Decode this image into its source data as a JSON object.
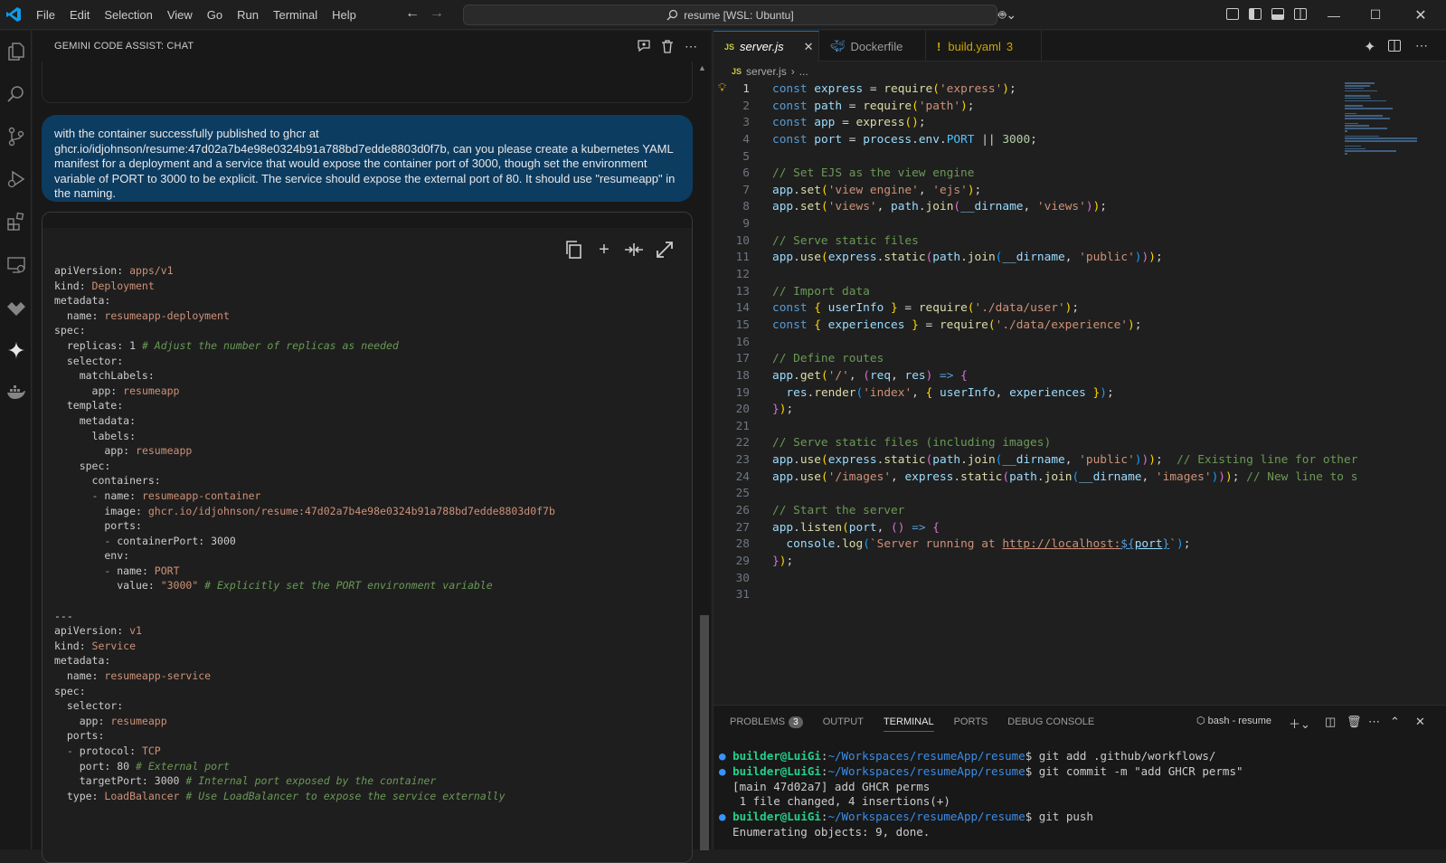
{
  "menu": [
    "File",
    "Edit",
    "Selection",
    "View",
    "Go",
    "Run",
    "Terminal",
    "Help"
  ],
  "command_center": "resume [WSL: Ubuntu]",
  "chat": {
    "title": "GEMINI CODE ASSIST: CHAT",
    "user_message": "with the container successfully published to ghcr at ghcr.io/idjohnson/resume:47d02a7b4e98e0324b91a788bd7edde8803d0f7b, can you please create a kubernetes YAML manifest for a deployment and a service that would expose the container port of 3000, though set the environment variable of PORT to 3000 to be explicit. The service should expose the external port of 80. It should use \"resumeapp\" in the naming.",
    "yaml": [
      [
        [
          "k",
          "apiVersion: "
        ],
        [
          "v",
          "apps/v1"
        ]
      ],
      [
        [
          "k",
          "kind: "
        ],
        [
          "v",
          "Deployment"
        ]
      ],
      [
        [
          "k",
          "metadata:"
        ]
      ],
      [
        [
          "k",
          "  name: "
        ],
        [
          "v",
          "resumeapp-deployment"
        ]
      ],
      [
        [
          "k",
          "spec:"
        ]
      ],
      [
        [
          "k",
          "  replicas: "
        ],
        [
          "d",
          "1 "
        ],
        [
          "c",
          "# Adjust the number of replicas as needed"
        ]
      ],
      [
        [
          "k",
          "  selector:"
        ]
      ],
      [
        [
          "k",
          "    matchLabels:"
        ]
      ],
      [
        [
          "k",
          "      app: "
        ],
        [
          "v",
          "resumeapp"
        ]
      ],
      [
        [
          "k",
          "  template:"
        ]
      ],
      [
        [
          "k",
          "    metadata:"
        ]
      ],
      [
        [
          "k",
          "      labels:"
        ]
      ],
      [
        [
          "k",
          "        app: "
        ],
        [
          "v",
          "resumeapp"
        ]
      ],
      [
        [
          "k",
          "    spec:"
        ]
      ],
      [
        [
          "k",
          "      containers:"
        ]
      ],
      [
        [
          "v",
          "      - "
        ],
        [
          "k",
          "name: "
        ],
        [
          "v",
          "resumeapp-container"
        ]
      ],
      [
        [
          "k",
          "        image: "
        ],
        [
          "v",
          "ghcr.io/idjohnson/resume:47d02a7b4e98e0324b91a788bd7edde8803d0f7b"
        ]
      ],
      [
        [
          "k",
          "        ports:"
        ]
      ],
      [
        [
          "v",
          "        - "
        ],
        [
          "k",
          "containerPort: "
        ],
        [
          "d",
          "3000"
        ]
      ],
      [
        [
          "k",
          "        env:"
        ]
      ],
      [
        [
          "v",
          "        - "
        ],
        [
          "k",
          "name: "
        ],
        [
          "v",
          "PORT"
        ]
      ],
      [
        [
          "k",
          "          value: "
        ],
        [
          "v",
          "\"3000\" "
        ],
        [
          "c",
          "# Explicitly set the PORT environment variable"
        ]
      ],
      [
        [
          "k",
          ""
        ]
      ],
      [
        [
          "d",
          "---"
        ]
      ],
      [
        [
          "k",
          "apiVersion: "
        ],
        [
          "v",
          "v1"
        ]
      ],
      [
        [
          "k",
          "kind: "
        ],
        [
          "v",
          "Service"
        ]
      ],
      [
        [
          "k",
          "metadata:"
        ]
      ],
      [
        [
          "k",
          "  name: "
        ],
        [
          "v",
          "resumeapp-service"
        ]
      ],
      [
        [
          "k",
          "spec:"
        ]
      ],
      [
        [
          "k",
          "  selector:"
        ]
      ],
      [
        [
          "k",
          "    app: "
        ],
        [
          "v",
          "resumeapp"
        ]
      ],
      [
        [
          "k",
          "  ports:"
        ]
      ],
      [
        [
          "v",
          "  - "
        ],
        [
          "k",
          "protocol: "
        ],
        [
          "v",
          "TCP"
        ]
      ],
      [
        [
          "k",
          "    port: "
        ],
        [
          "d",
          "80 "
        ],
        [
          "c",
          "# External port"
        ]
      ],
      [
        [
          "k",
          "    targetPort: "
        ],
        [
          "d",
          "3000 "
        ],
        [
          "c",
          "# Internal port exposed by the container"
        ]
      ],
      [
        [
          "k",
          "  type: "
        ],
        [
          "v",
          "LoadBalancer "
        ],
        [
          "c",
          "# Use LoadBalancer to expose the service externally"
        ]
      ]
    ]
  },
  "editor": {
    "tabs": [
      {
        "label": "server.js",
        "icon": "JS",
        "active": true
      },
      {
        "label": "Dockerfile",
        "icon": "docker"
      },
      {
        "label": "build.yaml",
        "icon": "!",
        "count": "3"
      }
    ],
    "breadcrumb_file": "server.js",
    "breadcrumb_rest": "...",
    "lines": [
      [
        [
          "kw",
          "const "
        ],
        [
          "vr",
          "express"
        ],
        [
          "pl",
          " = "
        ],
        [
          "fn",
          "require"
        ],
        [
          "br",
          "("
        ],
        [
          "st",
          "'express'"
        ],
        [
          "br",
          ")"
        ],
        [
          "pl",
          ";"
        ]
      ],
      [
        [
          "kw",
          "const "
        ],
        [
          "vr",
          "path"
        ],
        [
          "pl",
          " = "
        ],
        [
          "fn",
          "require"
        ],
        [
          "br",
          "("
        ],
        [
          "st",
          "'path'"
        ],
        [
          "br",
          ")"
        ],
        [
          "pl",
          ";"
        ]
      ],
      [
        [
          "kw",
          "const "
        ],
        [
          "vr",
          "app"
        ],
        [
          "pl",
          " = "
        ],
        [
          "fn",
          "express"
        ],
        [
          "br",
          "()"
        ],
        [
          "pl",
          ";"
        ]
      ],
      [
        [
          "kw",
          "const "
        ],
        [
          "vr",
          "port"
        ],
        [
          "pl",
          " = "
        ],
        [
          "vr",
          "process"
        ],
        [
          "pl",
          "."
        ],
        [
          "vr",
          "env"
        ],
        [
          "pl",
          "."
        ],
        [
          "cn",
          "PORT"
        ],
        [
          "pl",
          " || "
        ],
        [
          "nb",
          "3000"
        ],
        [
          "pl",
          ";"
        ]
      ],
      [],
      [
        [
          "cm",
          "// Set EJS as the view engine"
        ]
      ],
      [
        [
          "vr",
          "app"
        ],
        [
          "pl",
          "."
        ],
        [
          "fn",
          "set"
        ],
        [
          "br",
          "("
        ],
        [
          "st",
          "'view engine'"
        ],
        [
          "pl",
          ", "
        ],
        [
          "st",
          "'ejs'"
        ],
        [
          "br",
          ")"
        ],
        [
          "pl",
          ";"
        ]
      ],
      [
        [
          "vr",
          "app"
        ],
        [
          "pl",
          "."
        ],
        [
          "fn",
          "set"
        ],
        [
          "br",
          "("
        ],
        [
          "st",
          "'views'"
        ],
        [
          "pl",
          ", "
        ],
        [
          "vr",
          "path"
        ],
        [
          "pl",
          "."
        ],
        [
          "fn",
          "join"
        ],
        [
          "br2",
          "("
        ],
        [
          "vr",
          "__dirname"
        ],
        [
          "pl",
          ", "
        ],
        [
          "st",
          "'views'"
        ],
        [
          "br2",
          ")"
        ],
        [
          "br",
          ")"
        ],
        [
          "pl",
          ";"
        ]
      ],
      [],
      [
        [
          "cm",
          "// Serve static files"
        ]
      ],
      [
        [
          "vr",
          "app"
        ],
        [
          "pl",
          "."
        ],
        [
          "fn",
          "use"
        ],
        [
          "br",
          "("
        ],
        [
          "vr",
          "express"
        ],
        [
          "pl",
          "."
        ],
        [
          "fn",
          "static"
        ],
        [
          "br2",
          "("
        ],
        [
          "vr",
          "path"
        ],
        [
          "pl",
          "."
        ],
        [
          "fn",
          "join"
        ],
        [
          "br3",
          "("
        ],
        [
          "vr",
          "__dirname"
        ],
        [
          "pl",
          ", "
        ],
        [
          "st",
          "'public'"
        ],
        [
          "br3",
          ")"
        ],
        [
          "br2",
          ")"
        ],
        [
          "br",
          ")"
        ],
        [
          "pl",
          ";"
        ]
      ],
      [],
      [
        [
          "cm",
          "// Import data"
        ]
      ],
      [
        [
          "kw",
          "const "
        ],
        [
          "br",
          "{ "
        ],
        [
          "vr",
          "userInfo"
        ],
        [
          "br",
          " }"
        ],
        [
          "pl",
          " = "
        ],
        [
          "fn",
          "require"
        ],
        [
          "br",
          "("
        ],
        [
          "st",
          "'./data/user'"
        ],
        [
          "br",
          ")"
        ],
        [
          "pl",
          ";"
        ]
      ],
      [
        [
          "kw",
          "const "
        ],
        [
          "br",
          "{ "
        ],
        [
          "vr",
          "experiences"
        ],
        [
          "br",
          " }"
        ],
        [
          "pl",
          " = "
        ],
        [
          "fn",
          "require"
        ],
        [
          "br",
          "("
        ],
        [
          "st",
          "'./data/experience'"
        ],
        [
          "br",
          ")"
        ],
        [
          "pl",
          ";"
        ]
      ],
      [],
      [
        [
          "cm",
          "// Define routes"
        ]
      ],
      [
        [
          "vr",
          "app"
        ],
        [
          "pl",
          "."
        ],
        [
          "fn",
          "get"
        ],
        [
          "br",
          "("
        ],
        [
          "st",
          "'/'"
        ],
        [
          "pl",
          ", "
        ],
        [
          "br2",
          "("
        ],
        [
          "vr",
          "req"
        ],
        [
          "pl",
          ", "
        ],
        [
          "vr",
          "res"
        ],
        [
          "br2",
          ")"
        ],
        [
          "kw",
          " => "
        ],
        [
          "br2",
          "{"
        ]
      ],
      [
        [
          "pl",
          "  "
        ],
        [
          "vr",
          "res"
        ],
        [
          "pl",
          "."
        ],
        [
          "fn",
          "render"
        ],
        [
          "br3",
          "("
        ],
        [
          "st",
          "'index'"
        ],
        [
          "pl",
          ", "
        ],
        [
          "br",
          "{ "
        ],
        [
          "vr",
          "userInfo"
        ],
        [
          "pl",
          ", "
        ],
        [
          "vr",
          "experiences"
        ],
        [
          "br",
          " }"
        ],
        [
          "br3",
          ")"
        ],
        [
          "pl",
          ";"
        ]
      ],
      [
        [
          "br2",
          "}"
        ],
        [
          "br",
          ")"
        ],
        [
          "pl",
          ";"
        ]
      ],
      [],
      [
        [
          "cm",
          "// Serve static files (including images)"
        ]
      ],
      [
        [
          "vr",
          "app"
        ],
        [
          "pl",
          "."
        ],
        [
          "fn",
          "use"
        ],
        [
          "br",
          "("
        ],
        [
          "vr",
          "express"
        ],
        [
          "pl",
          "."
        ],
        [
          "fn",
          "static"
        ],
        [
          "br2",
          "("
        ],
        [
          "vr",
          "path"
        ],
        [
          "pl",
          "."
        ],
        [
          "fn",
          "join"
        ],
        [
          "br3",
          "("
        ],
        [
          "vr",
          "__dirname"
        ],
        [
          "pl",
          ", "
        ],
        [
          "st",
          "'public'"
        ],
        [
          "br3",
          ")"
        ],
        [
          "br2",
          ")"
        ],
        [
          "br",
          ")"
        ],
        [
          "pl",
          ";  "
        ],
        [
          "cm",
          "// Existing line for other"
        ]
      ],
      [
        [
          "vr",
          "app"
        ],
        [
          "pl",
          "."
        ],
        [
          "fn",
          "use"
        ],
        [
          "br",
          "("
        ],
        [
          "st",
          "'/images'"
        ],
        [
          "pl",
          ", "
        ],
        [
          "vr",
          "express"
        ],
        [
          "pl",
          "."
        ],
        [
          "fn",
          "static"
        ],
        [
          "br2",
          "("
        ],
        [
          "vr",
          "path"
        ],
        [
          "pl",
          "."
        ],
        [
          "fn",
          "join"
        ],
        [
          "br3",
          "("
        ],
        [
          "vr",
          "__dirname"
        ],
        [
          "pl",
          ", "
        ],
        [
          "st",
          "'images'"
        ],
        [
          "br3",
          ")"
        ],
        [
          "br2",
          ")"
        ],
        [
          "br",
          ")"
        ],
        [
          "pl",
          "; "
        ],
        [
          "cm",
          "// New line to s"
        ]
      ],
      [],
      [
        [
          "cm",
          "// Start the server"
        ]
      ],
      [
        [
          "vr",
          "app"
        ],
        [
          "pl",
          "."
        ],
        [
          "fn",
          "listen"
        ],
        [
          "br",
          "("
        ],
        [
          "vr",
          "port"
        ],
        [
          "pl",
          ", "
        ],
        [
          "br2",
          "()"
        ],
        [
          "kw",
          " => "
        ],
        [
          "br2",
          "{"
        ]
      ],
      [
        [
          "pl",
          "  "
        ],
        [
          "vr",
          "console"
        ],
        [
          "pl",
          "."
        ],
        [
          "fn",
          "log"
        ],
        [
          "br3",
          "("
        ],
        [
          "st",
          "`Server running at "
        ],
        [
          "stu",
          "http://localhost:"
        ],
        [
          "kwu",
          "${"
        ],
        [
          "vru",
          "port"
        ],
        [
          "kwu",
          "}"
        ],
        [
          "st",
          "`"
        ],
        [
          "br3",
          ")"
        ],
        [
          "pl",
          ";"
        ]
      ],
      [
        [
          "br2",
          "}"
        ],
        [
          "br",
          ")"
        ],
        [
          "pl",
          ";"
        ]
      ],
      [],
      []
    ]
  },
  "panel": {
    "tabs": [
      "PROBLEMS",
      "OUTPUT",
      "TERMINAL",
      "PORTS",
      "DEBUG CONSOLE"
    ],
    "problems_count": "3",
    "active_tab": "TERMINAL",
    "terminal_name": "bash - resume",
    "terminal": [
      {
        "prompt": true,
        "user": "builder@LuiGi",
        "path": "~/Workspaces/resumeApp/resume",
        "cmd": "git add .github/workflows/"
      },
      {
        "prompt": true,
        "user": "builder@LuiGi",
        "path": "~/Workspaces/resumeApp/resume",
        "cmd": "git commit -m \"add GHCR perms\""
      },
      {
        "prompt": false,
        "text": "[main 47d02a7] add GHCR perms"
      },
      {
        "prompt": false,
        "text": " 1 file changed, 4 insertions(+)"
      },
      {
        "prompt": true,
        "user": "builder@LuiGi",
        "path": "~/Workspaces/resumeApp/resume",
        "cmd": "git push"
      },
      {
        "prompt": false,
        "text": "Enumerating objects: 9, done."
      }
    ]
  }
}
